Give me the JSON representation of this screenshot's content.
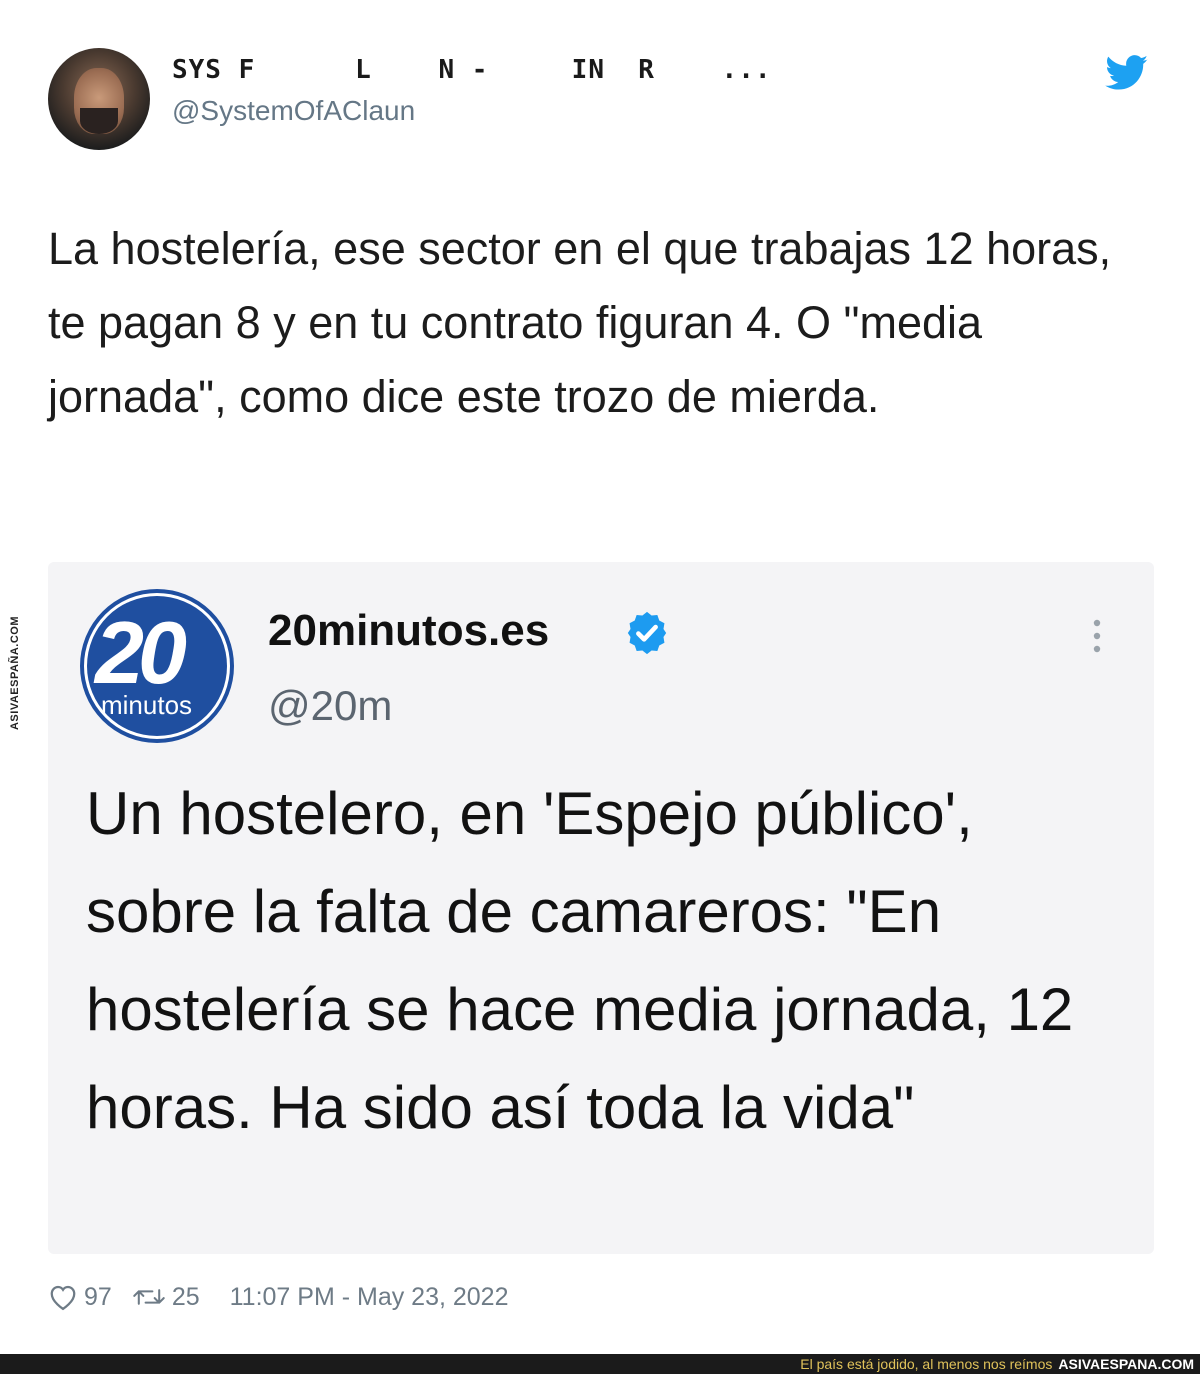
{
  "tweet": {
    "user_name": "SYS F      L    N -     IN  R    ...",
    "user_handle": "@SystemOfAClaun",
    "text": "La hostelería, ese sector en el que trabajas 12 horas, te pagan 8 y en tu contrato figuran 4. O \"media jornada\", como dice este trozo de mierda.",
    "brand_icon": "twitter-bird-icon",
    "likes": "97",
    "retweets": "25",
    "timestamp": "11:07 PM - May 23, 2022"
  },
  "quoted_tweet": {
    "avatar_number": "20",
    "avatar_word": "minutos",
    "name": "20minutos.es",
    "handle": "@20m",
    "verified": true,
    "text": "Un hostelero, en 'Espejo público', sobre la falta de camareros: \"En hostelería se hace media jornada, 12 horas. Ha sido así toda la vida\""
  },
  "watermark": {
    "side_text": "ASIVAESPAÑA.COM",
    "caption": "El país está jodido, al menos nos reímos",
    "site": "ASIVAESPANA.COM"
  },
  "colors": {
    "twitter_blue": "#1da1f2",
    "verified_blue": "#1d9bf0",
    "quote_background": "#f4f4f6",
    "brand_20m_blue": "#1f4fa0",
    "caption_yellow": "#e0c25a"
  }
}
